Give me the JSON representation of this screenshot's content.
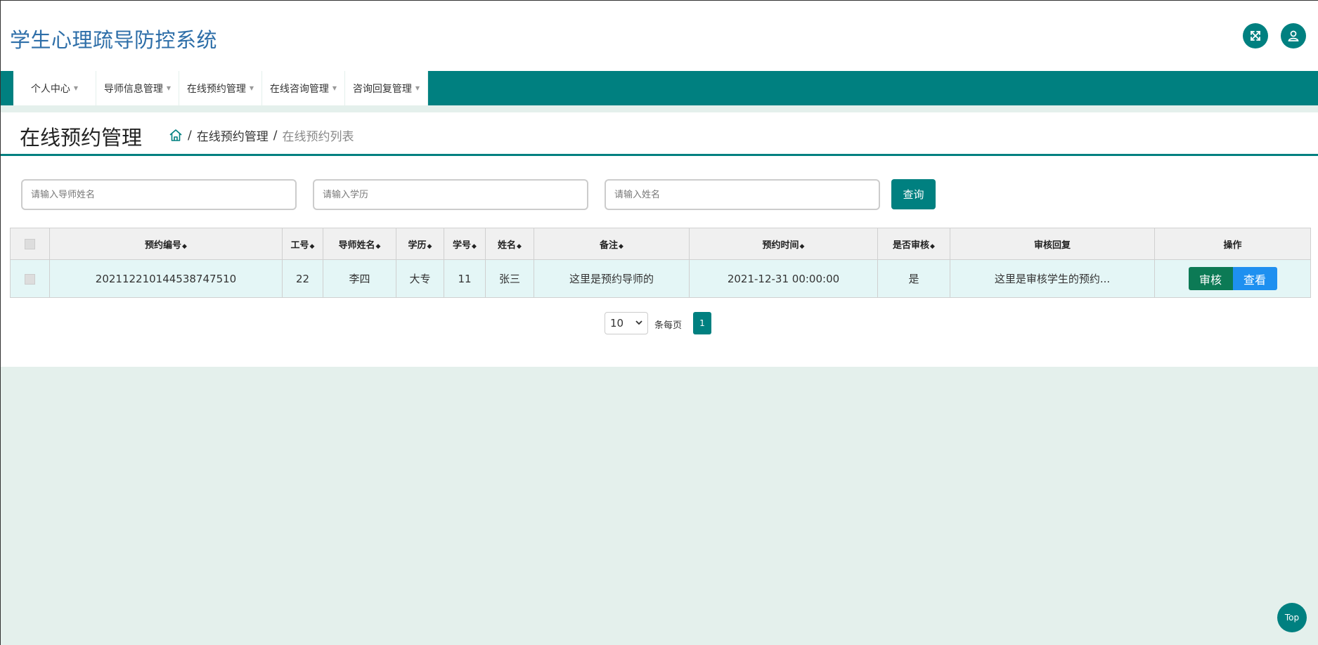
{
  "app": {
    "title": "学生心理疏导防控系统"
  },
  "header": {
    "fullscreen_icon": "fullscreen-icon",
    "user_icon": "user-icon"
  },
  "nav": {
    "items": [
      {
        "label": "个人中心"
      },
      {
        "label": "导师信息管理"
      },
      {
        "label": "在线预约管理"
      },
      {
        "label": "在线咨询管理"
      },
      {
        "label": "咨询回复管理"
      }
    ]
  },
  "page": {
    "heading": "在线预约管理",
    "breadcrumb": {
      "level1": "在线预约管理",
      "level2": "在线预约列表",
      "separator": "/"
    }
  },
  "search": {
    "tutor_name_placeholder": "请输入导师姓名",
    "education_placeholder": "请输入学历",
    "name_placeholder": "请输入姓名",
    "query_label": "查询"
  },
  "table": {
    "headers": {
      "appointment_no": "预约编号",
      "staff_no": "工号",
      "tutor_name": "导师姓名",
      "education": "学历",
      "student_no": "学号",
      "name": "姓名",
      "remark": "备注",
      "appointment_time": "预约时间",
      "is_reviewed": "是否审核",
      "review_reply": "审核回复",
      "actions": "操作"
    },
    "rows": [
      {
        "appointment_no": "20211221014453874751​0",
        "staff_no": "22",
        "tutor_name": "李四",
        "education": "大专",
        "student_no": "11",
        "name": "张三",
        "remark": "这里是预约导师的",
        "appointment_time": "2021-12-31 00:00:00",
        "is_reviewed": "是",
        "review_reply": "这里是审核学生的预约...",
        "audit_label": "审核",
        "view_label": "查看"
      }
    ]
  },
  "pagination": {
    "page_size": "10",
    "per_page_label": "条每页",
    "current_page": "1"
  },
  "back_to_top": {
    "label": "Top"
  },
  "colors": {
    "primary": "#008080",
    "title_blue": "#2d6ea8",
    "audit_green": "#0c7a55",
    "view_blue": "#1e90f0",
    "page_bg": "#e4f0ec"
  }
}
